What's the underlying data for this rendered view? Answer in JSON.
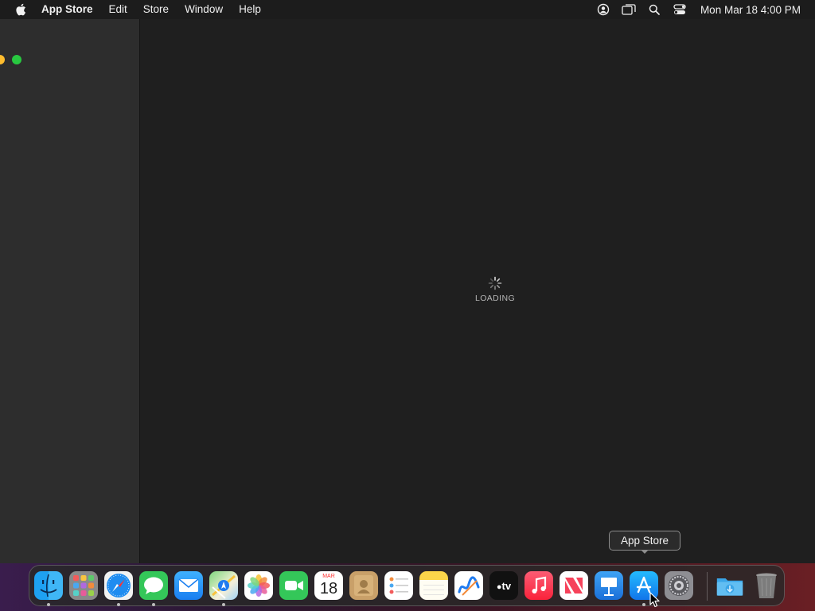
{
  "menubar": {
    "apple_icon": "apple-logo-icon",
    "app_name": "App Store",
    "menus": [
      "Edit",
      "Store",
      "Window",
      "Help"
    ],
    "status_icons": [
      "user-account-icon",
      "screen-mirroring-icon",
      "spotlight-search-icon",
      "control-center-icon"
    ],
    "clock": "Mon Mar 18  4:00 PM"
  },
  "window": {
    "traffic_lights": [
      "minimize",
      "zoom"
    ],
    "loading_text": "LOADING"
  },
  "dock": {
    "items": [
      {
        "name": "Finder",
        "icon": "finder-icon",
        "running": true
      },
      {
        "name": "Launchpad",
        "icon": "launchpad-icon",
        "running": false
      },
      {
        "name": "Safari",
        "icon": "safari-icon",
        "running": true
      },
      {
        "name": "Messages",
        "icon": "messages-icon",
        "running": true
      },
      {
        "name": "Mail",
        "icon": "mail-icon",
        "running": false
      },
      {
        "name": "Maps",
        "icon": "maps-icon",
        "running": true
      },
      {
        "name": "Photos",
        "icon": "photos-icon",
        "running": false
      },
      {
        "name": "FaceTime",
        "icon": "facetime-icon",
        "running": false
      },
      {
        "name": "Calendar",
        "icon": "calendar-icon",
        "running": false,
        "month": "MAR",
        "day": "18"
      },
      {
        "name": "Contacts",
        "icon": "contacts-icon",
        "running": false
      },
      {
        "name": "Reminders",
        "icon": "reminders-icon",
        "running": false
      },
      {
        "name": "Notes",
        "icon": "notes-icon",
        "running": false
      },
      {
        "name": "Freeform",
        "icon": "freeform-icon",
        "running": false
      },
      {
        "name": "TV",
        "icon": "apple-tv-icon",
        "running": false,
        "label": "tv"
      },
      {
        "name": "Music",
        "icon": "music-icon",
        "running": false
      },
      {
        "name": "News",
        "icon": "news-icon",
        "running": false
      },
      {
        "name": "Keynote",
        "icon": "keynote-icon",
        "running": false
      },
      {
        "name": "App Store",
        "icon": "app-store-icon",
        "running": true
      },
      {
        "name": "System Settings",
        "icon": "system-settings-icon",
        "running": false
      },
      {
        "name": "Downloads",
        "icon": "downloads-folder-icon",
        "running": false
      },
      {
        "name": "Trash",
        "icon": "trash-icon",
        "running": false
      }
    ],
    "tooltip": "App Store"
  },
  "colors": {
    "menubar_bg": "#1c1c1c",
    "sidebar_bg": "#2d2d2d",
    "content_bg": "#1f1f1f",
    "traffic_yellow": "#febc2e",
    "traffic_green": "#28c840"
  }
}
